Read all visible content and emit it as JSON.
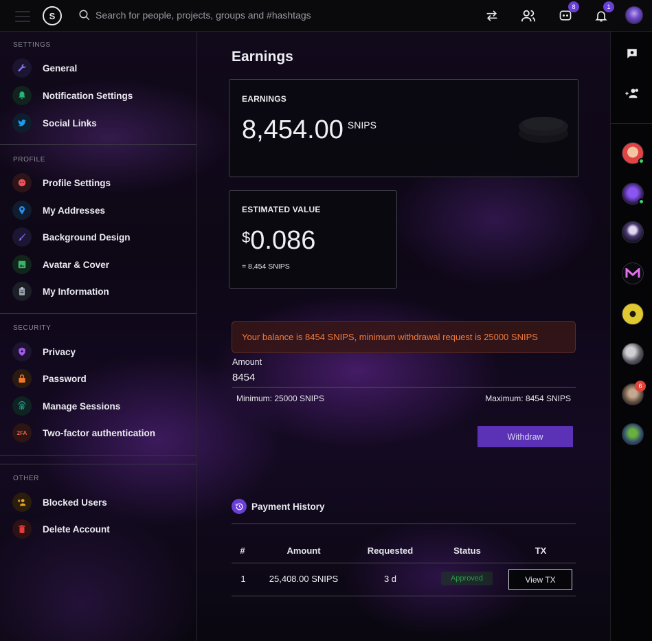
{
  "topbar": {
    "logo_letter": "S",
    "search_placeholder": "Search for people, projects, groups and #hashtags",
    "messages_badge": "8",
    "notifications_badge": "1"
  },
  "sidebar": {
    "sections": [
      {
        "title": "SETTINGS",
        "items": [
          "General",
          "Notification Settings",
          "Social Links"
        ]
      },
      {
        "title": "PROFILE",
        "items": [
          "Profile Settings",
          "My Addresses",
          "Background Design",
          "Avatar & Cover",
          "My Information"
        ]
      },
      {
        "title": "SECURITY",
        "items": [
          "Privacy",
          "Password",
          "Manage Sessions",
          "Two-factor authentication"
        ]
      },
      {
        "title": "OTHER",
        "items": [
          "Blocked Users",
          "Delete Account"
        ]
      }
    ],
    "twofa_icon_text": "2FA"
  },
  "main": {
    "title": "Earnings",
    "earnings_card": {
      "label": "EARNINGS",
      "value": "8,454.00",
      "unit": "SNIPS"
    },
    "estimate_card": {
      "label": "ESTIMATED VALUE",
      "currency": "$",
      "value": "0.086",
      "sub": "= 8,454 SNIPS"
    },
    "alert": "Your balance is 8454 SNIPS, minimum withdrawal request is 25000 SNIPS",
    "amount_label": "Amount",
    "amount_value": "8454",
    "minimum": "Minimum: 25000 SNIPS",
    "maximum": "Maximum: 8454 SNIPS",
    "withdraw_label": "Withdraw",
    "history_title": "Payment History",
    "table": {
      "headers": [
        "#",
        "Amount",
        "Requested",
        "Status",
        "TX"
      ],
      "rows": [
        {
          "num": "1",
          "amount": "25,408.00 SNIPS",
          "requested": "3 d",
          "status": "Approved",
          "tx": "View TX"
        }
      ]
    }
  },
  "rail": {
    "friend_badge": "6"
  },
  "colors": {
    "accent": "#6a3fd6",
    "button": "#5b32b5",
    "alert_text": "#f07a3a",
    "approved": "#2f9a4a",
    "online": "#3ed36a",
    "badge_red": "#e0443a"
  }
}
